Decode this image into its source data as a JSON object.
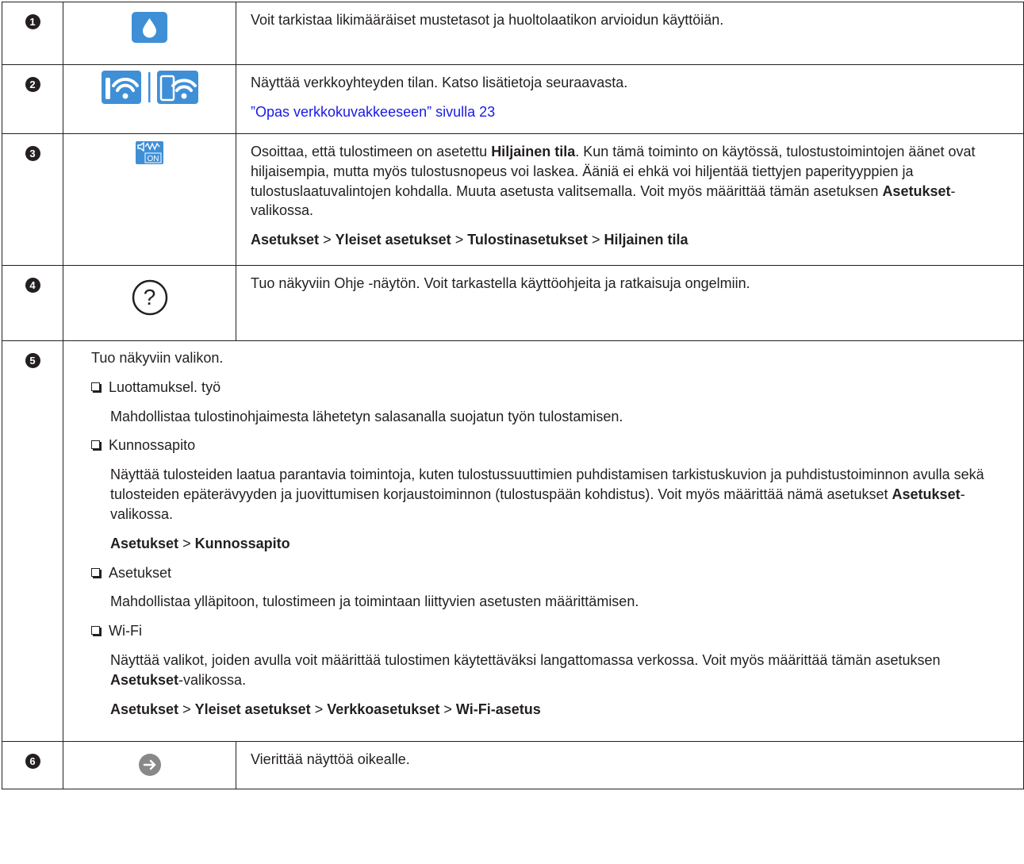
{
  "rows": [
    {
      "num": "1",
      "icon": "ink-drop-icon",
      "text": "Voit tarkistaa likimääräiset mustetasot ja huoltolaatikon arvioidun käyttöiän."
    },
    {
      "num": "2",
      "icon": "wifi-status-icon",
      "text": "Näyttää verkkoyhteyden tilan. Katso lisätietoja seuraavasta.",
      "link": "”Opas verkkokuvakkeeseen” sivulla 23"
    },
    {
      "num": "3",
      "icon": "quiet-mode-on-icon",
      "text_a": "Osoittaa, että tulostimeen on asetettu ",
      "bold_a": "Hiljainen tila",
      "text_b": ". Kun tämä toiminto on käytössä, tulostustoimintojen äänet ovat hiljaisempia, mutta myös tulostusnopeus voi laskea. Ääniä ei ehkä voi hiljentää tiettyjen paperityyppien ja tulostuslaatuvalintojen kohdalla. Muuta asetusta valitsemalla. Voit myös määrittää tämän asetuksen ",
      "bold_b": "Asetukset",
      "text_c": "-valikossa.",
      "path": [
        "Asetukset",
        "Yleiset asetukset",
        "Tulostinasetukset",
        "Hiljainen tila"
      ]
    },
    {
      "num": "4",
      "icon": "help-icon",
      "help_glyph": "?",
      "text": "Tuo näkyviin Ohje -näytön. Voit tarkastella käyttöohjeita ja ratkaisuja ongelmiin."
    },
    {
      "num": "5",
      "intro": "Tuo näkyviin valikon.",
      "items": [
        {
          "label": "Luottamuksel. työ",
          "desc": "Mahdollistaa tulostinohjaimesta lähetetyn salasanalla suojatun työn tulostamisen."
        },
        {
          "label": "Kunnossapito",
          "desc_a": "Näyttää tulosteiden laatua parantavia toimintoja, kuten tulostussuuttimien puhdistamisen tarkistuskuvion ja puhdistustoiminnon avulla sekä tulosteiden epäterävyyden ja juovittumisen korjaustoiminnon (tulostuspään kohdistus). Voit myös määrittää nämä asetukset ",
          "bold": "Asetukset",
          "desc_b": "-valikossa.",
          "path": [
            "Asetukset",
            "Kunnossapito"
          ]
        },
        {
          "label": "Asetukset",
          "desc": "Mahdollistaa ylläpitoon, tulostimeen ja toimintaan liittyvien asetusten määrittämisen."
        },
        {
          "label": "Wi-Fi",
          "desc_a": "Näyttää valikot, joiden avulla voit määrittää tulostimen käytettäväksi langattomassa verkossa. Voit myös määrittää tämän asetuksen ",
          "bold": "Asetukset",
          "desc_b": "-valikossa.",
          "path": [
            "Asetukset",
            "Yleiset asetukset",
            "Verkkoasetukset",
            "Wi-Fi-asetus"
          ]
        }
      ]
    },
    {
      "num": "6",
      "icon": "arrow-right-icon",
      "text": "Vierittää näyttöä oikealle."
    }
  ],
  "separator": ">",
  "colors": {
    "text": "#231f20",
    "link": "#1a1ae6",
    "icon_blue": "#3f8fd6",
    "icon_gray": "#888888"
  }
}
